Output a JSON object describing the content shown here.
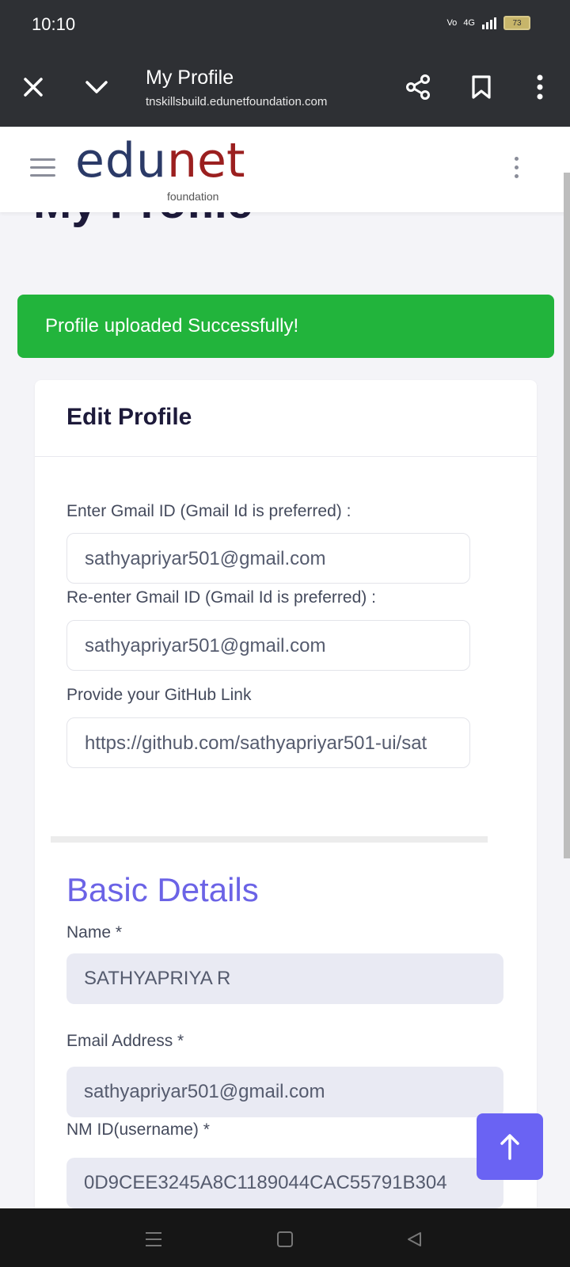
{
  "status_bar": {
    "time": "10:10",
    "battery": "73",
    "network": "4G"
  },
  "browser": {
    "title": "My Profile",
    "url": "tnskillsbuild.edunetfoundation.com"
  },
  "site": {
    "logo_main_a": "edu",
    "logo_main_b": "net",
    "logo_sub": "foundation"
  },
  "page": {
    "heading": "My Profile"
  },
  "alert": {
    "message": "Profile uploaded Successfully!"
  },
  "edit_profile": {
    "title": "Edit Profile",
    "gmail_label": "Enter Gmail ID (Gmail Id is preferred) :",
    "gmail_value": "sathyapriyar501@gmail.com",
    "regmail_label": "Re-enter Gmail ID (Gmail Id is preferred) :",
    "regmail_value": "sathyapriyar501@gmail.com",
    "github_label": "Provide your GitHub Link",
    "github_value": "https://github.com/sathyapriyar501-ui/sat"
  },
  "basic_details": {
    "title": "Basic Details",
    "name_label": "Name *",
    "name_value": "SATHYAPRIYA R",
    "email_label": "Email Address *",
    "email_value": "sathyapriyar501@gmail.com",
    "nmid_label": "NM ID(username) *",
    "nmid_value": "0D9CEE3245A8C1189044CAC55791B304"
  },
  "colors": {
    "accent": "#6b63e6",
    "success": "#22b43c",
    "browser_bar": "#2e3034"
  }
}
